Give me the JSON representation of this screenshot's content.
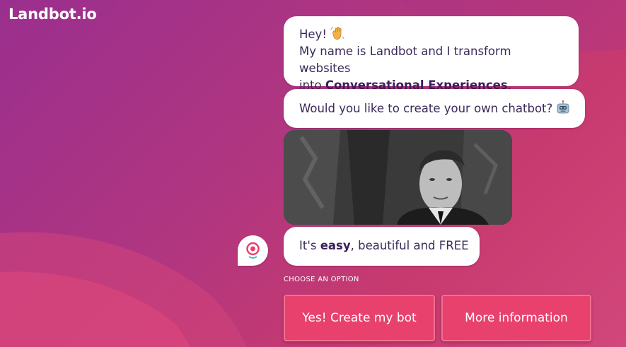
{
  "brand": {
    "logo_text": "Landbot.io"
  },
  "chat": {
    "message1": {
      "line1": "Hey!",
      "line2": "My name is Landbot and I transform websites",
      "line3_prefix": "into ",
      "line3_bold": "Conversational Experiences",
      "line3_suffix": "."
    },
    "message2": {
      "text": "Would you like to create your own chatbot?"
    },
    "message3": {
      "prefix": "It's ",
      "bold": "easy",
      "suffix": ", beautiful and FREE"
    },
    "icons": {
      "wave": "waving-hand-icon",
      "robot": "robot-icon",
      "avatar": "bot-avatar-icon",
      "media": "animated-gif"
    }
  },
  "options": {
    "heading": "CHOOSE AN OPTION",
    "buttons": [
      {
        "label": "Yes! Create my bot"
      },
      {
        "label": "More information"
      }
    ]
  },
  "colors": {
    "background_start": "#9a2f8e",
    "background_end": "#d2477b",
    "button": "#e8416e",
    "bubble": "#ffffff",
    "text": "#3a2a5a"
  }
}
